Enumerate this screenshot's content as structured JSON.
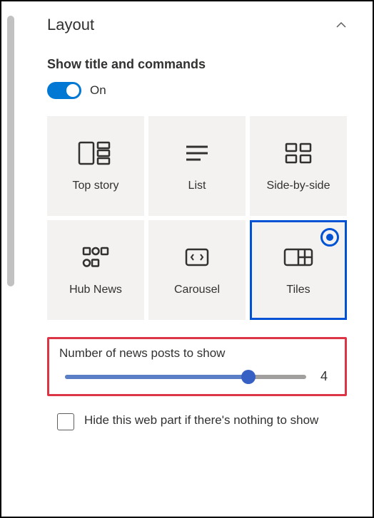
{
  "section": {
    "title": "Layout",
    "subtitle": "Show title and commands"
  },
  "toggle": {
    "state_label": "On"
  },
  "layout_options": [
    {
      "label": "Top story"
    },
    {
      "label": "List"
    },
    {
      "label": "Side-by-side"
    },
    {
      "label": "Hub News"
    },
    {
      "label": "Carousel"
    },
    {
      "label": "Tiles"
    }
  ],
  "slider": {
    "label": "Number of news posts to show",
    "value": "4"
  },
  "hide_checkbox": {
    "label": "Hide this web part if there's nothing to show"
  }
}
